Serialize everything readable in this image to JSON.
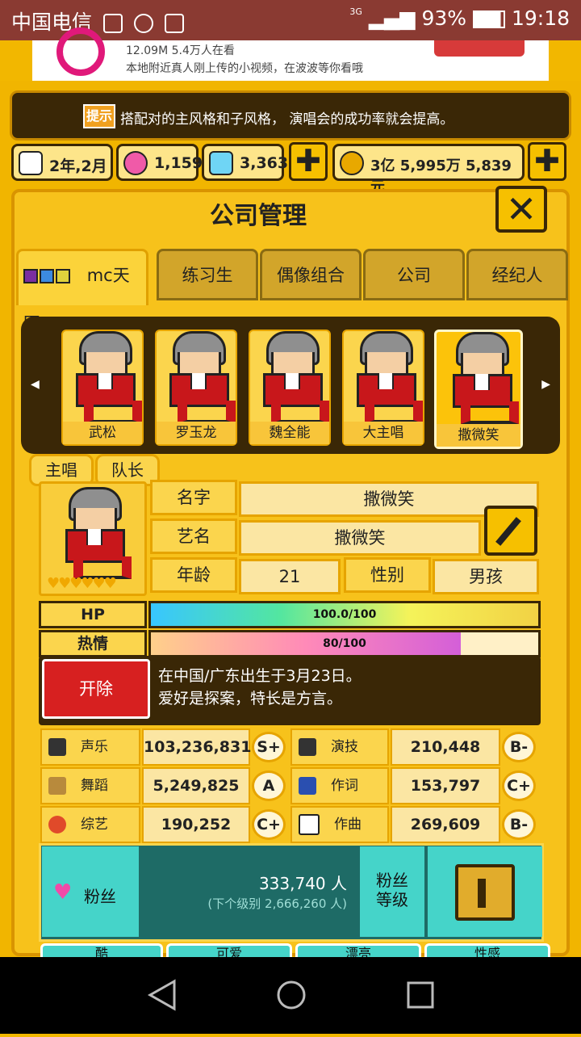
{
  "status_bar": {
    "carrier": "中国电信",
    "battery": "93%",
    "time": "19:18",
    "network": "3G"
  },
  "ad": {
    "line1": "12.09M 5.4万人在看",
    "line2": "本地附近真人刚上传的小视频，在波波等你看哦"
  },
  "hint": {
    "tag": "提示",
    "text": "搭配对的主风格和子风格， 演唱会的成功率就会提高。"
  },
  "resources": {
    "date": "2年,2月",
    "pink_gems": "1,159",
    "blue_gems": "3,363",
    "money": "3亿 5,995万 5,839元",
    "plus": "✚"
  },
  "panel": {
    "title": "公司管理",
    "close": "✕"
  },
  "tabs": [
    {
      "label": "mc天团"
    },
    {
      "label": "练习生"
    },
    {
      "label": "偶像组合"
    },
    {
      "label": "公司"
    },
    {
      "label": "经纪人"
    }
  ],
  "members": [
    {
      "name": "武松"
    },
    {
      "name": "罗玉龙"
    },
    {
      "name": "魏全能"
    },
    {
      "name": "大主唱"
    },
    {
      "name": "撒微笑"
    }
  ],
  "profile": {
    "badge_role": "主唱",
    "badge_leader": "队长",
    "name_label": "名字",
    "name_value": "撒微笑",
    "stage_label": "艺名",
    "stage_value": "撒微笑",
    "age_label": "年龄",
    "age_value": "21",
    "gender_label": "性别",
    "gender_value": "男孩",
    "hearts": "♥♥♥♥♥♥"
  },
  "bars": {
    "hp_label": "HP",
    "hp_text": "100.0/100",
    "hp_fraction": 1.0,
    "passion_label": "热情",
    "passion_text": "80/100",
    "passion_fraction": 0.8
  },
  "bio": {
    "fire_button": "开除",
    "line1": "在中国/广东出生于3月23日。",
    "line2": "爱好是探案，特长是方言。"
  },
  "stats": [
    {
      "label": "声乐",
      "value": "103,236,831",
      "grade": "S+"
    },
    {
      "label": "演技",
      "value": "210,448",
      "grade": "B-"
    },
    {
      "label": "舞蹈",
      "value": "5,249,825",
      "grade": "A"
    },
    {
      "label": "作词",
      "value": "153,797",
      "grade": "C+"
    },
    {
      "label": "综艺",
      "value": "190,252",
      "grade": "C+"
    },
    {
      "label": "作曲",
      "value": "269,609",
      "grade": "B-"
    }
  ],
  "fans": {
    "label": "粉丝",
    "count": "333,740 人",
    "next_level": "(下个级别 2,666,260 人)",
    "level_label": "粉丝\n等级"
  },
  "bottom_tabs": [
    {
      "label": "酷"
    },
    {
      "label": "可爱"
    },
    {
      "label": "漂亮"
    },
    {
      "label": "性感"
    }
  ],
  "colors": {
    "primary_gold": "#f2b700",
    "dark_brown": "#3a2706",
    "teal": "#45d4c9",
    "red": "#d72020"
  }
}
